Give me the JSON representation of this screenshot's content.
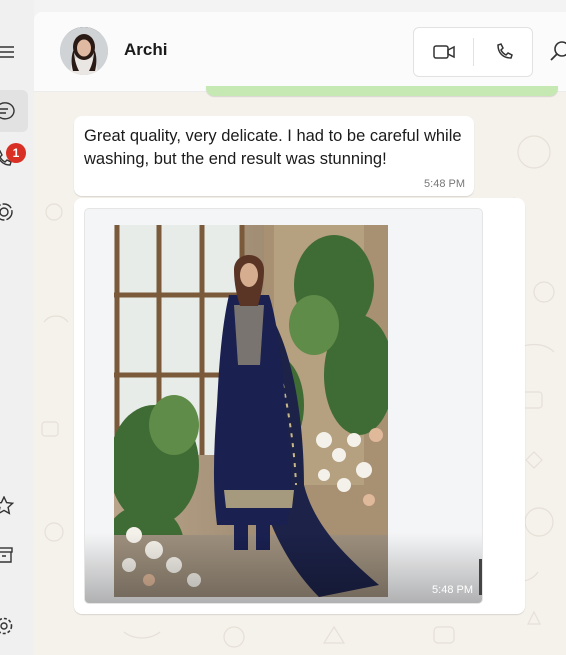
{
  "rail": {
    "badge_count": "1",
    "items": [
      {
        "icon": "menu-icon"
      },
      {
        "icon": "chats-icon",
        "active": true
      },
      {
        "icon": "calls-icon"
      },
      {
        "icon": "status-icon"
      },
      {
        "icon": "starred-icon"
      },
      {
        "icon": "archive-icon"
      },
      {
        "icon": "settings-icon"
      }
    ]
  },
  "header": {
    "contact_name": "Archi",
    "buttons": [
      {
        "icon": "video-call-icon"
      },
      {
        "icon": "voice-call-icon"
      },
      {
        "icon": "search-icon"
      }
    ]
  },
  "messages": [
    {
      "type": "text",
      "text": "Great quality, very delicate. I had to be careful while washing, but the end result was stunning!",
      "time": "5:48 PM"
    },
    {
      "type": "image",
      "image_subject": "model in navy embroidered suit with dupatta beside window and flowers",
      "time": "5:48 PM"
    }
  ],
  "colors": {
    "chat_background": "#f5f1eb",
    "outgoing_bubble": "#c6e9b4",
    "incoming_bubble": "#ffffff",
    "badge": "#d93025"
  }
}
